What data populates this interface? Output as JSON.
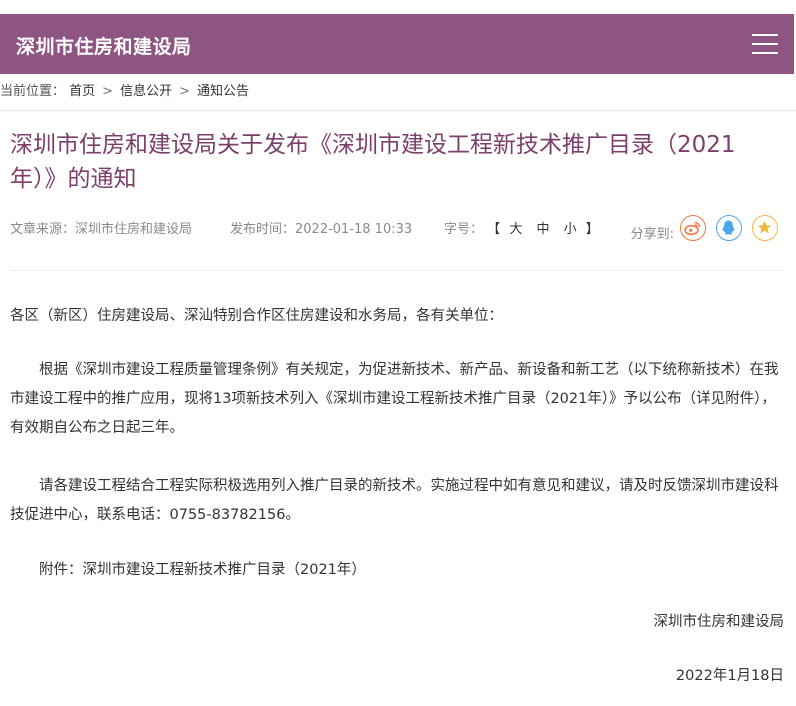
{
  "header": {
    "site_title": "深圳市住房和建设局",
    "bg_color": "#8e5482",
    "menu_icon": "hamburger-menu-icon"
  },
  "breadcrumb": {
    "label": "当前位置：",
    "items": [
      "首页",
      "信息公开",
      "通知公告"
    ],
    "separator": ">"
  },
  "article": {
    "title": "深圳市住房和建设局关于发布《深圳市建设工程新技术推广目录（2021年）》的通知",
    "title_color": "#7c3f6c",
    "meta": {
      "source": "文章来源：深圳市住房和建设局",
      "published": "发布时间：2022-01-18 10:33",
      "font_size_label": "字号：",
      "font_size_open": "【",
      "font_size_options": [
        "大",
        "中",
        "小"
      ],
      "font_size_close": "】"
    },
    "share": {
      "label": "分享到:",
      "icons": [
        "weibo-icon",
        "qq-icon",
        "qzone-icon"
      ]
    },
    "body": {
      "greeting": "各区（新区）住房建设局、深汕特别合作区住房建设和水务局，各有关单位：",
      "paragraphs": [
        "根据《深圳市建设工程质量管理条例》有关规定，为促进新技术、新产品、新设备和新工艺（以下统称新技术）在我市建设工程中的推广应用，现将13项新技术列入《深圳市建设工程新技术推广目录（2021年）》予以公布（详见附件），有效期自公布之日起三年。",
        "请各建设工程结合工程实际积极选用列入推广目录的新技术。实施过程中如有意见和建议，请及时反馈深圳市建设科技促进中心，联系电话：0755-83782156。",
        "附件：深圳市建设工程新技术推广目录（2021年）"
      ],
      "signature_org": "深圳市住房和建设局",
      "signature_date": "2022年1月18日"
    }
  }
}
